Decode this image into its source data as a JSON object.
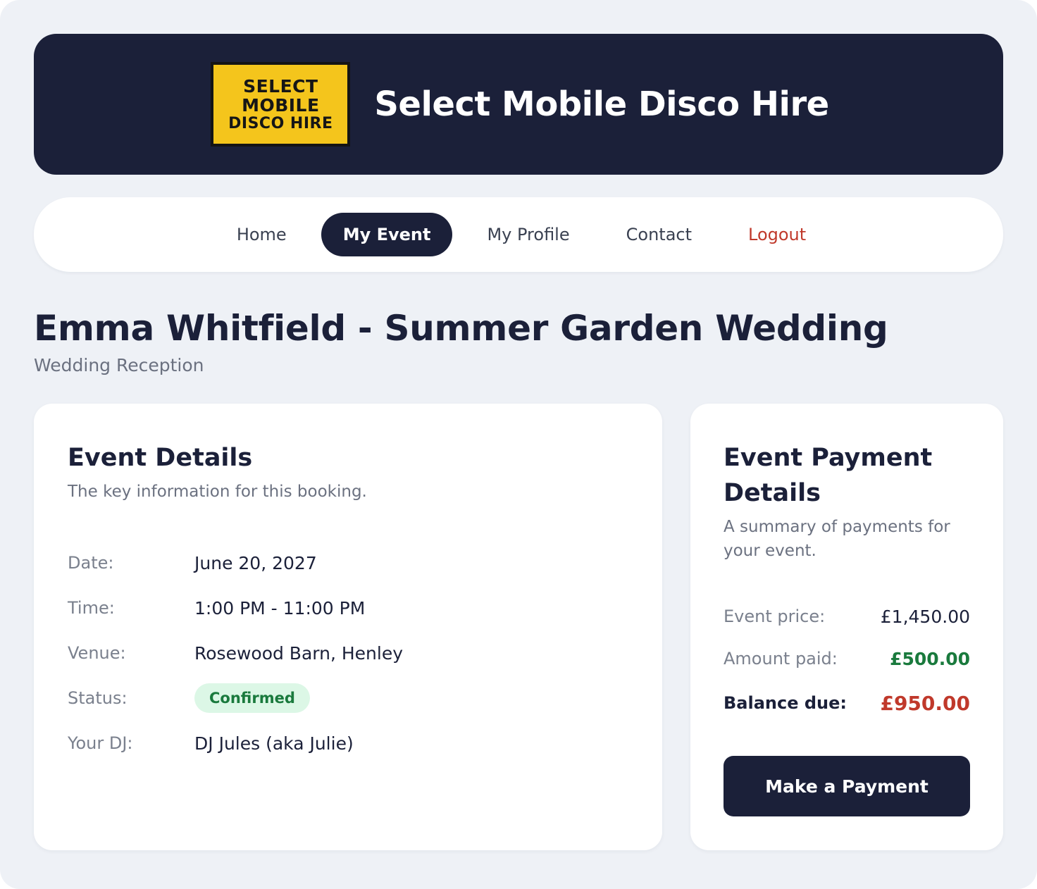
{
  "header": {
    "logo_lines": [
      "SELECT",
      "MOBILE",
      "DISCO HIRE"
    ],
    "title": "Select Mobile Disco Hire"
  },
  "nav": {
    "items": [
      {
        "label": "Home"
      },
      {
        "label": "My Event",
        "active": true
      },
      {
        "label": "My Profile"
      },
      {
        "label": "Contact"
      },
      {
        "label": "Logout"
      }
    ]
  },
  "page": {
    "title": "Emma Whitfield - Summer Garden Wedding",
    "subtitle": "Wedding Reception"
  },
  "event_details": {
    "title": "Event Details",
    "subtitle": "The key information for this booking.",
    "rows": [
      {
        "label": "Date:",
        "value": "June 20, 2027"
      },
      {
        "label": "Time:",
        "value": "1:00 PM - 11:00 PM"
      },
      {
        "label": "Venue:",
        "value": "Rosewood Barn, Henley"
      },
      {
        "label": "Status:",
        "value": "Confirmed"
      },
      {
        "label": "Your DJ:",
        "value": "DJ Jules (aka Julie)"
      }
    ]
  },
  "payment": {
    "title": "Event Payment Details",
    "subtitle": "A summary of payments for your event.",
    "rows": [
      {
        "label": "Event price:",
        "value": "£1,450.00"
      },
      {
        "label": "Amount paid:",
        "value": "£500.00"
      },
      {
        "label": "Balance due:",
        "value": "£950.00"
      }
    ],
    "button_label": "Make a Payment"
  },
  "colors": {
    "navy": "#1b2039",
    "logo_yellow": "#f4c51c",
    "page_bg": "#eef1f6",
    "success_green": "#1a7a3d",
    "badge_green_bg": "#dcf7e6",
    "danger_red": "#c0392b"
  }
}
